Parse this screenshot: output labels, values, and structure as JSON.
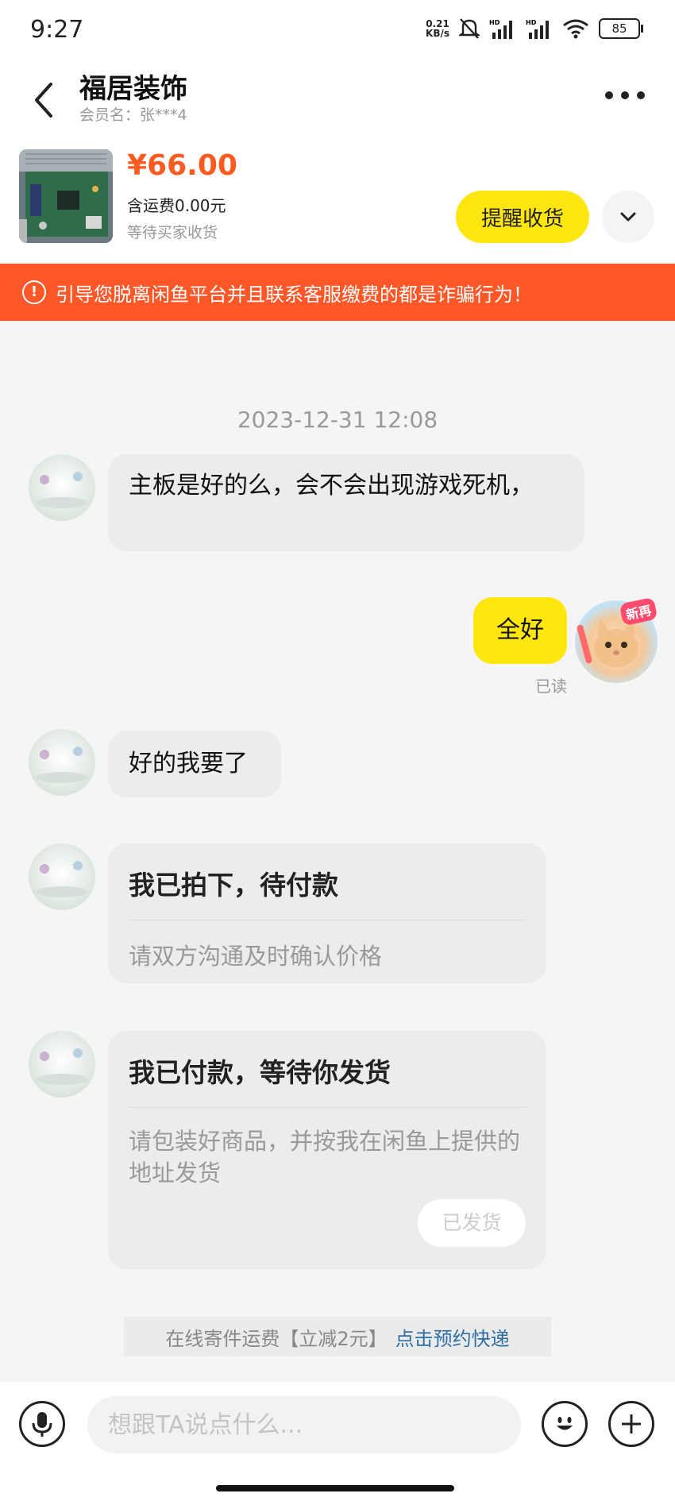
{
  "status_bar": {
    "time": "9:27",
    "net_speed_value": "0.21",
    "net_speed_unit": "KB/s",
    "battery": "85"
  },
  "header": {
    "shop_name": "福居装饰",
    "member_label": "会员名：张***4",
    "price": "¥66.00",
    "shipping_fee": "含运费0.00元",
    "order_status": "等待买家收货",
    "remind_button": "提醒收货"
  },
  "warning": {
    "text": "引导您脱离闲鱼平台并且联系客服缴费的都是诈骗行为！"
  },
  "chat": {
    "timestamp": "2023-12-31 12:08",
    "msg1": "主板是好的么，会不会出现游戏死机，",
    "msg2": "全好",
    "msg2_status": "已读",
    "msg3": "好的我要了",
    "card1": {
      "title": "我已拍下，待付款",
      "subtitle": "请双方沟通及时确认价格"
    },
    "card2": {
      "title": "我已付款，等待你发货",
      "subtitle": "请包装好商品，并按我在闲鱼上提供的地址发货",
      "button": "已发货"
    },
    "my_avatar_badge": "新再"
  },
  "promo": {
    "text": "在线寄件运费【立减2元】",
    "link": "点击预约快递"
  },
  "input": {
    "placeholder": "想跟TA说点什么..."
  },
  "colors": {
    "accent_yellow": "#ffe60f",
    "warning_orange": "#ff5727",
    "price_orange": "#ff5a1f",
    "link_blue": "#2e6ea6"
  }
}
